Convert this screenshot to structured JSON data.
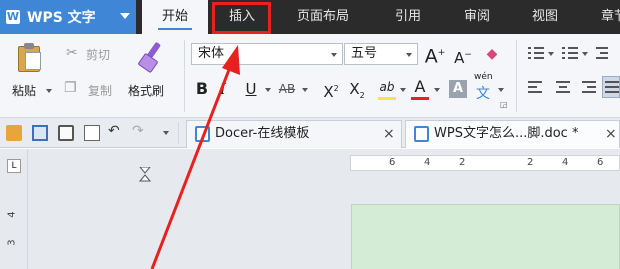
{
  "menubar": {
    "app_name": "WPS 文字",
    "app_logo": "W",
    "tabs": [
      {
        "label": "开始"
      },
      {
        "label": "插入"
      },
      {
        "label": "页面布局"
      },
      {
        "label": "引用"
      },
      {
        "label": "审阅"
      },
      {
        "label": "视图"
      },
      {
        "label": "章节"
      }
    ],
    "active_tab": "插入",
    "highlight_color": "#e8201f"
  },
  "ribbon": {
    "clipboard": {
      "paste": "粘贴",
      "cut": "剪切",
      "copy": "复制",
      "format_painter": "格式刷"
    },
    "font": {
      "family": "宋体",
      "size": "五号",
      "bold": "B",
      "italic": "I",
      "underline": "U",
      "strike": "AB",
      "superscript_base": "X",
      "superscript_mark": "2",
      "subscript_base": "X",
      "subscript_mark": "2",
      "grow": "A",
      "shrink": "A",
      "highlight": "ab",
      "color": "A",
      "shading": "A",
      "phonetic": "wén",
      "phonetic_char": "文"
    },
    "colors": {
      "highlight": "#f7e34a",
      "font_color": "#e8201f"
    }
  },
  "doc_tabs": [
    {
      "title": "Docer-在线模板",
      "close": "×"
    },
    {
      "title": "WPS文字怎么...脚.doc *",
      "close": "×"
    }
  ],
  "ruler": {
    "h_numbers": [
      "6",
      "4",
      "2",
      "2",
      "4",
      "6"
    ],
    "v_numbers": [
      "4",
      "3"
    ],
    "corner": "L"
  },
  "colors": {
    "accent": "#3f86d6",
    "menubar_bg": "#2b2b2b",
    "page_bg": "#d4ebd5",
    "arrow": "#e8201f"
  }
}
